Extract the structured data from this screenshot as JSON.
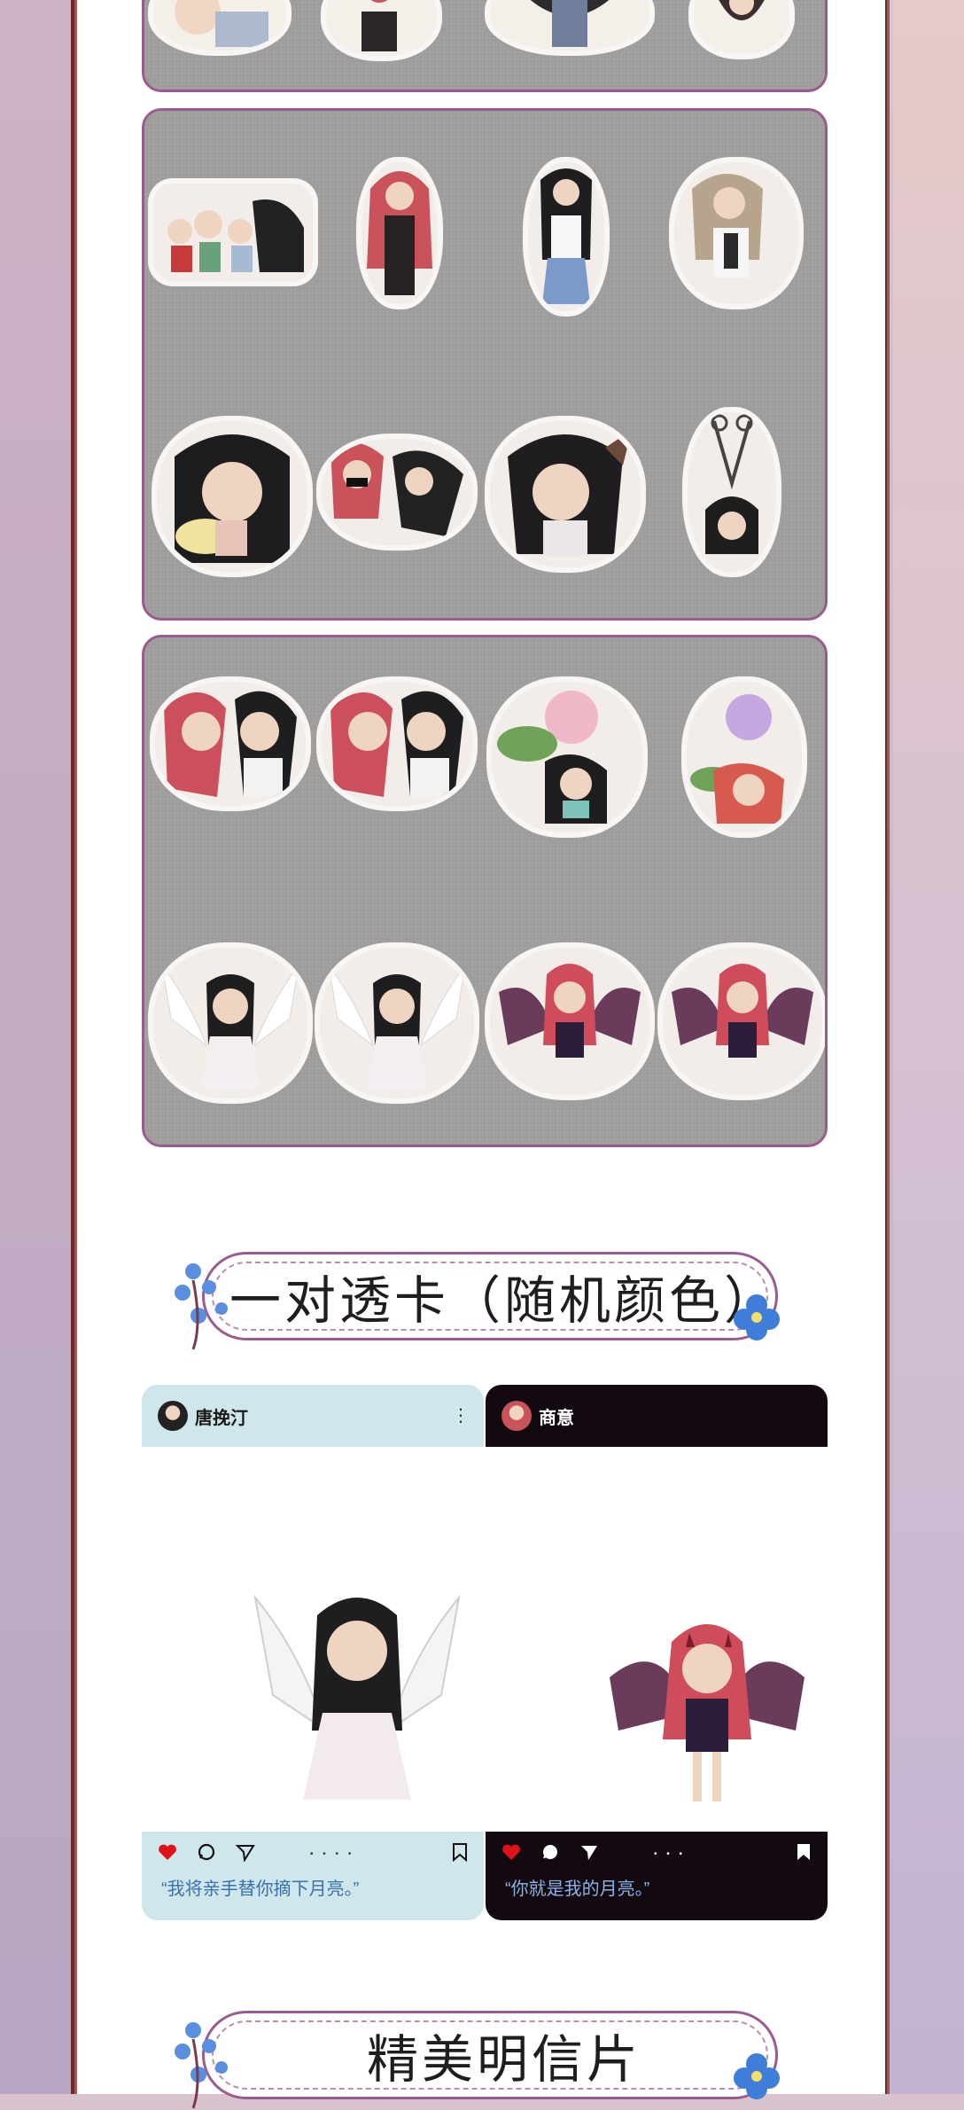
{
  "banners": {
    "cards_title": "一对透卡（随机颜色）",
    "postcards_title": "精美明信片"
  },
  "cards": [
    {
      "username": "唐挽汀",
      "caption": "“我将亲手替你摘下月亮。”",
      "theme": "light",
      "header_color": "#cfe6ea",
      "icon": "angel-character"
    },
    {
      "username": "商意",
      "caption": "“你就是我的月亮。”",
      "theme": "dark",
      "header_color": "#120a10",
      "icon": "devil-character"
    }
  ],
  "colors": {
    "panel_border": "#9a5c8f",
    "frame": "#6b2c2a",
    "like_red": "#e0131b"
  }
}
